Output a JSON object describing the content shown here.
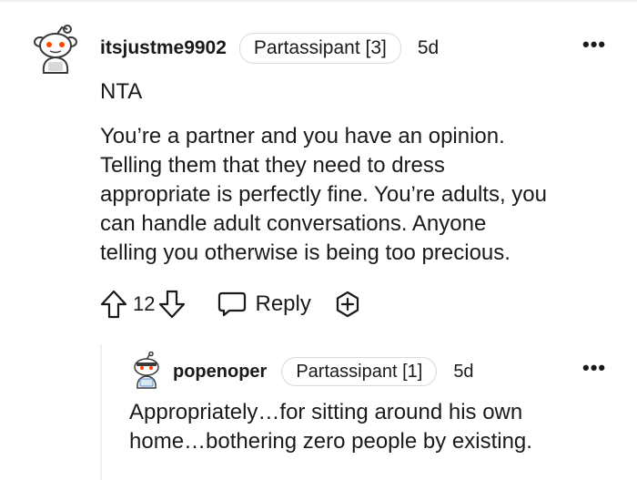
{
  "comment": {
    "username": "itsjustme9902",
    "flair": "Partassipant [3]",
    "age": "5d",
    "verdict": "NTA",
    "body_lines": [
      "You’re a partner and you have an opinion.",
      "Telling them that they need to dress",
      "appropriate is perfectly fine. You’re adults, you",
      "can handle adult conversations. Anyone",
      "telling you otherwise is being too precious."
    ],
    "score": "12",
    "reply_label": "Reply",
    "more_label": "•••",
    "icons": {
      "avatar": "snoo-avatar-icon",
      "upvote": "upvote-arrow-icon",
      "downvote": "downvote-arrow-icon",
      "reply": "speech-bubble-icon",
      "award": "add-award-icon"
    }
  },
  "reply": {
    "username": "popenoper",
    "flair": "Partassipant [1]",
    "age": "5d",
    "body_lines": [
      "Appropriately…for sitting around his own",
      "home…bothering zero people by existing."
    ],
    "more_label": "•••",
    "icons": {
      "avatar": "snoo-avatar-icon"
    }
  },
  "colors": {
    "text": "#1a1a1b",
    "flair_border": "#d7dadc",
    "thread_line": "#edeff1",
    "avatar_red": "#ff4500"
  }
}
